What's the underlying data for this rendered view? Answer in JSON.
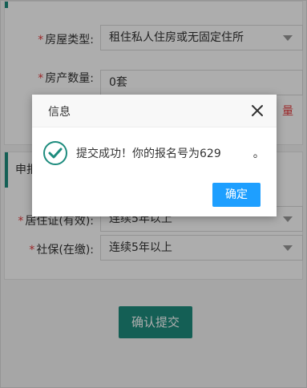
{
  "form": {
    "housing_type": {
      "label": "房屋类型:",
      "value": "租住私人住房或无固定住所"
    },
    "property_count": {
      "label": "房产数量:",
      "value": "0套"
    },
    "right_fragment": "量",
    "section_title": "申报",
    "residence_permit": {
      "label": "居住证(有效):",
      "value": "连续5年以上"
    },
    "social_security": {
      "label": "社保(在缴):",
      "value": "连续5年以上"
    },
    "required_mark": "*",
    "submit_label": "确认提交"
  },
  "dialog": {
    "title": "信息",
    "message": "提交成功！你的报名号为629",
    "message_end": "。",
    "ok_label": "确定",
    "close_icon": "close-icon",
    "status_icon": "success-check-icon"
  },
  "colors": {
    "accent": "#1e8c7e",
    "primary_button": "#1e9fff",
    "required": "#e4393c"
  }
}
